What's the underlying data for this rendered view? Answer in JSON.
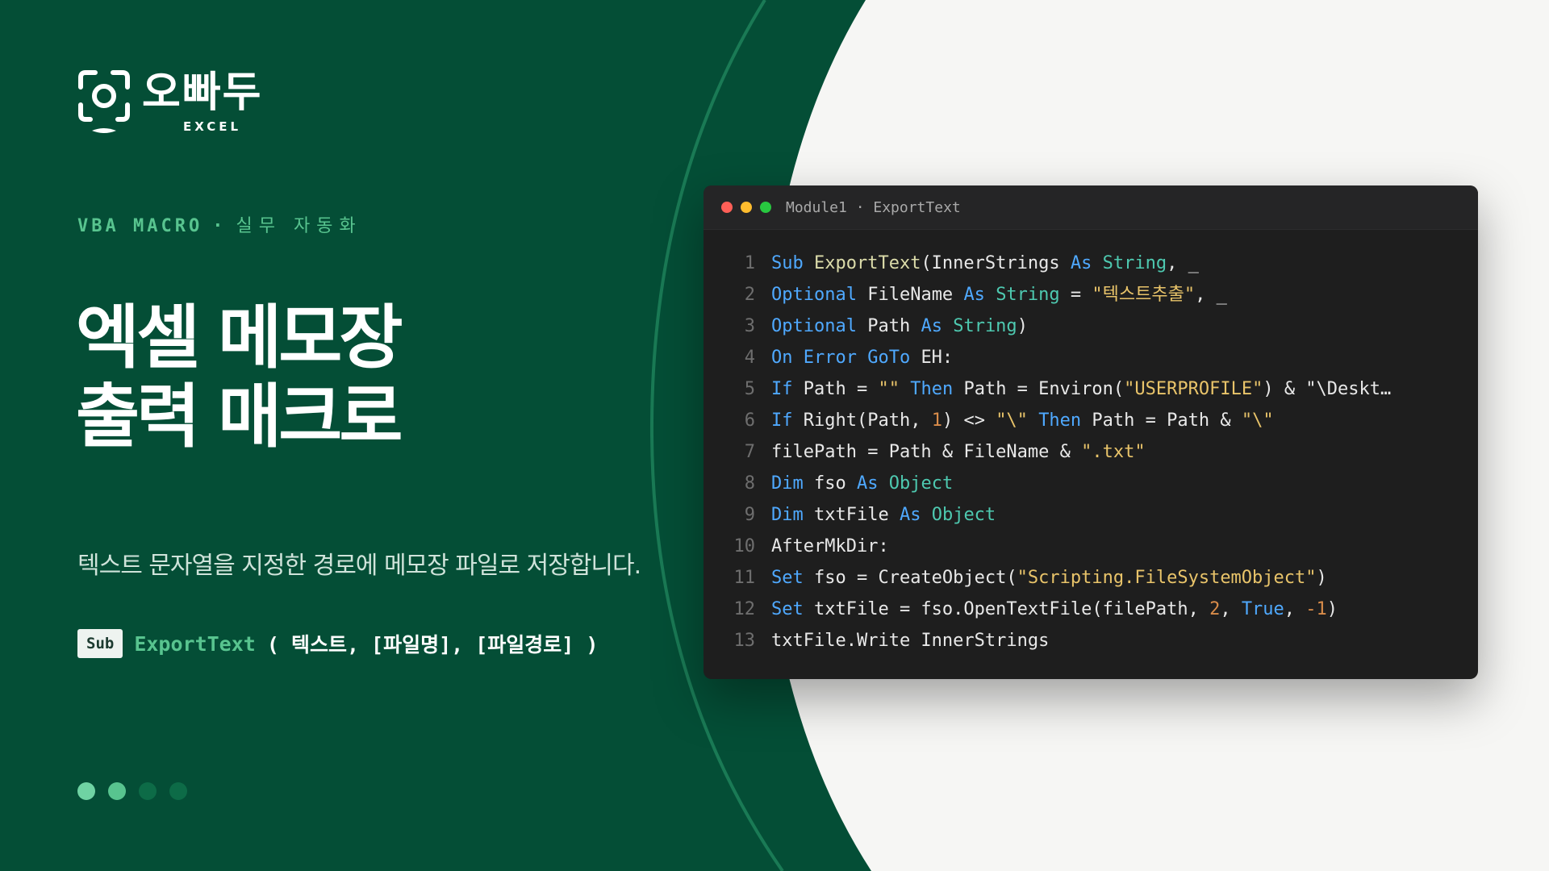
{
  "colors": {
    "panel_green": "#044e36",
    "accent_green": "#58c48f",
    "editor_bg": "#1e1e1e",
    "keyword": "#4fa9ff",
    "type": "#4ec9b0",
    "string": "#e9c46a"
  },
  "brand": {
    "icon": "camera-frame-icon",
    "name": "오빠두",
    "sub": "EXCEL"
  },
  "kicker": {
    "en": "VBA MACRO",
    "separator": "·",
    "ko": "실무 자동화"
  },
  "title": {
    "line1": "엑셀 메모장",
    "line2": "출력 매크로"
  },
  "subtitle": "텍스트 문자열을 지정한 경로에 메모장 파일로 저장합니다.",
  "signature": {
    "badge": "Sub",
    "function": "ExportText",
    "args": "( 텍스트, [파일명], [파일경로] )"
  },
  "pagination": {
    "total": 4,
    "active": 2
  },
  "editor": {
    "title": "Module1 · ExportText",
    "lines": [
      {
        "n": "1",
        "tokens": [
          [
            "kw",
            "Sub "
          ],
          [
            "fn",
            "ExportText"
          ],
          [
            "",
            "(InnerStrings "
          ],
          [
            "kw",
            "As "
          ],
          [
            "ty",
            "String"
          ],
          [
            "",
            ", _"
          ]
        ]
      },
      {
        "n": "2",
        "tokens": [
          [
            "kw",
            "Optional "
          ],
          [
            "",
            "FileName "
          ],
          [
            "kw",
            "As "
          ],
          [
            "ty",
            "String"
          ],
          [
            "",
            " = "
          ],
          [
            "st",
            "\"텍스트추출\""
          ],
          [
            "",
            ", _"
          ]
        ]
      },
      {
        "n": "3",
        "tokens": [
          [
            "kw",
            "Optional "
          ],
          [
            "",
            "Path "
          ],
          [
            "kw",
            "As "
          ],
          [
            "ty",
            "String"
          ],
          [
            "",
            ")"
          ]
        ]
      },
      {
        "n": "4",
        "tokens": [
          [
            "kw",
            "On Error GoTo "
          ],
          [
            "",
            "EH:"
          ]
        ]
      },
      {
        "n": "5",
        "tokens": [
          [
            "kw",
            "If "
          ],
          [
            "",
            "Path = "
          ],
          [
            "st",
            "\"\""
          ],
          [
            "",
            " "
          ],
          [
            "kw",
            "Then "
          ],
          [
            "",
            "Path = Environ("
          ],
          [
            "st",
            "\"USERPROFILE\""
          ],
          [
            "",
            ") & \"\\Deskt…"
          ]
        ]
      },
      {
        "n": "6",
        "tokens": [
          [
            "kw",
            "If "
          ],
          [
            "",
            "Right(Path, "
          ],
          [
            "nm",
            "1"
          ],
          [
            "",
            ") <> "
          ],
          [
            "st",
            "\"\\\""
          ],
          [
            "",
            " "
          ],
          [
            "kw",
            "Then "
          ],
          [
            "",
            "Path = Path & "
          ],
          [
            "st",
            "\"\\\""
          ]
        ]
      },
      {
        "n": "7",
        "tokens": [
          [
            "",
            "filePath = Path & FileName & "
          ],
          [
            "st",
            "\".txt\""
          ]
        ]
      },
      {
        "n": "8",
        "tokens": [
          [
            "kw",
            "Dim "
          ],
          [
            "",
            "fso "
          ],
          [
            "kw",
            "As "
          ],
          [
            "ty",
            "Object"
          ]
        ]
      },
      {
        "n": "9",
        "tokens": [
          [
            "kw",
            "Dim "
          ],
          [
            "",
            "txtFile "
          ],
          [
            "kw",
            "As "
          ],
          [
            "ty",
            "Object"
          ]
        ]
      },
      {
        "n": "10",
        "tokens": [
          [
            "",
            "AfterMkDir:"
          ]
        ]
      },
      {
        "n": "11",
        "tokens": [
          [
            "kw",
            "Set "
          ],
          [
            "",
            "fso = CreateObject("
          ],
          [
            "st",
            "\"Scripting.FileSystemObject\""
          ],
          [
            "",
            ")"
          ]
        ]
      },
      {
        "n": "12",
        "tokens": [
          [
            "kw",
            "Set "
          ],
          [
            "",
            "txtFile = fso.OpenTextFile(filePath, "
          ],
          [
            "nm",
            "2"
          ],
          [
            "",
            ", "
          ],
          [
            "kw",
            "True"
          ],
          [
            "",
            ", "
          ],
          [
            "nm",
            "-1"
          ],
          [
            "",
            ")"
          ]
        ]
      },
      {
        "n": "13",
        "tokens": [
          [
            "",
            "txtFile.Write InnerStrings"
          ]
        ]
      }
    ]
  }
}
